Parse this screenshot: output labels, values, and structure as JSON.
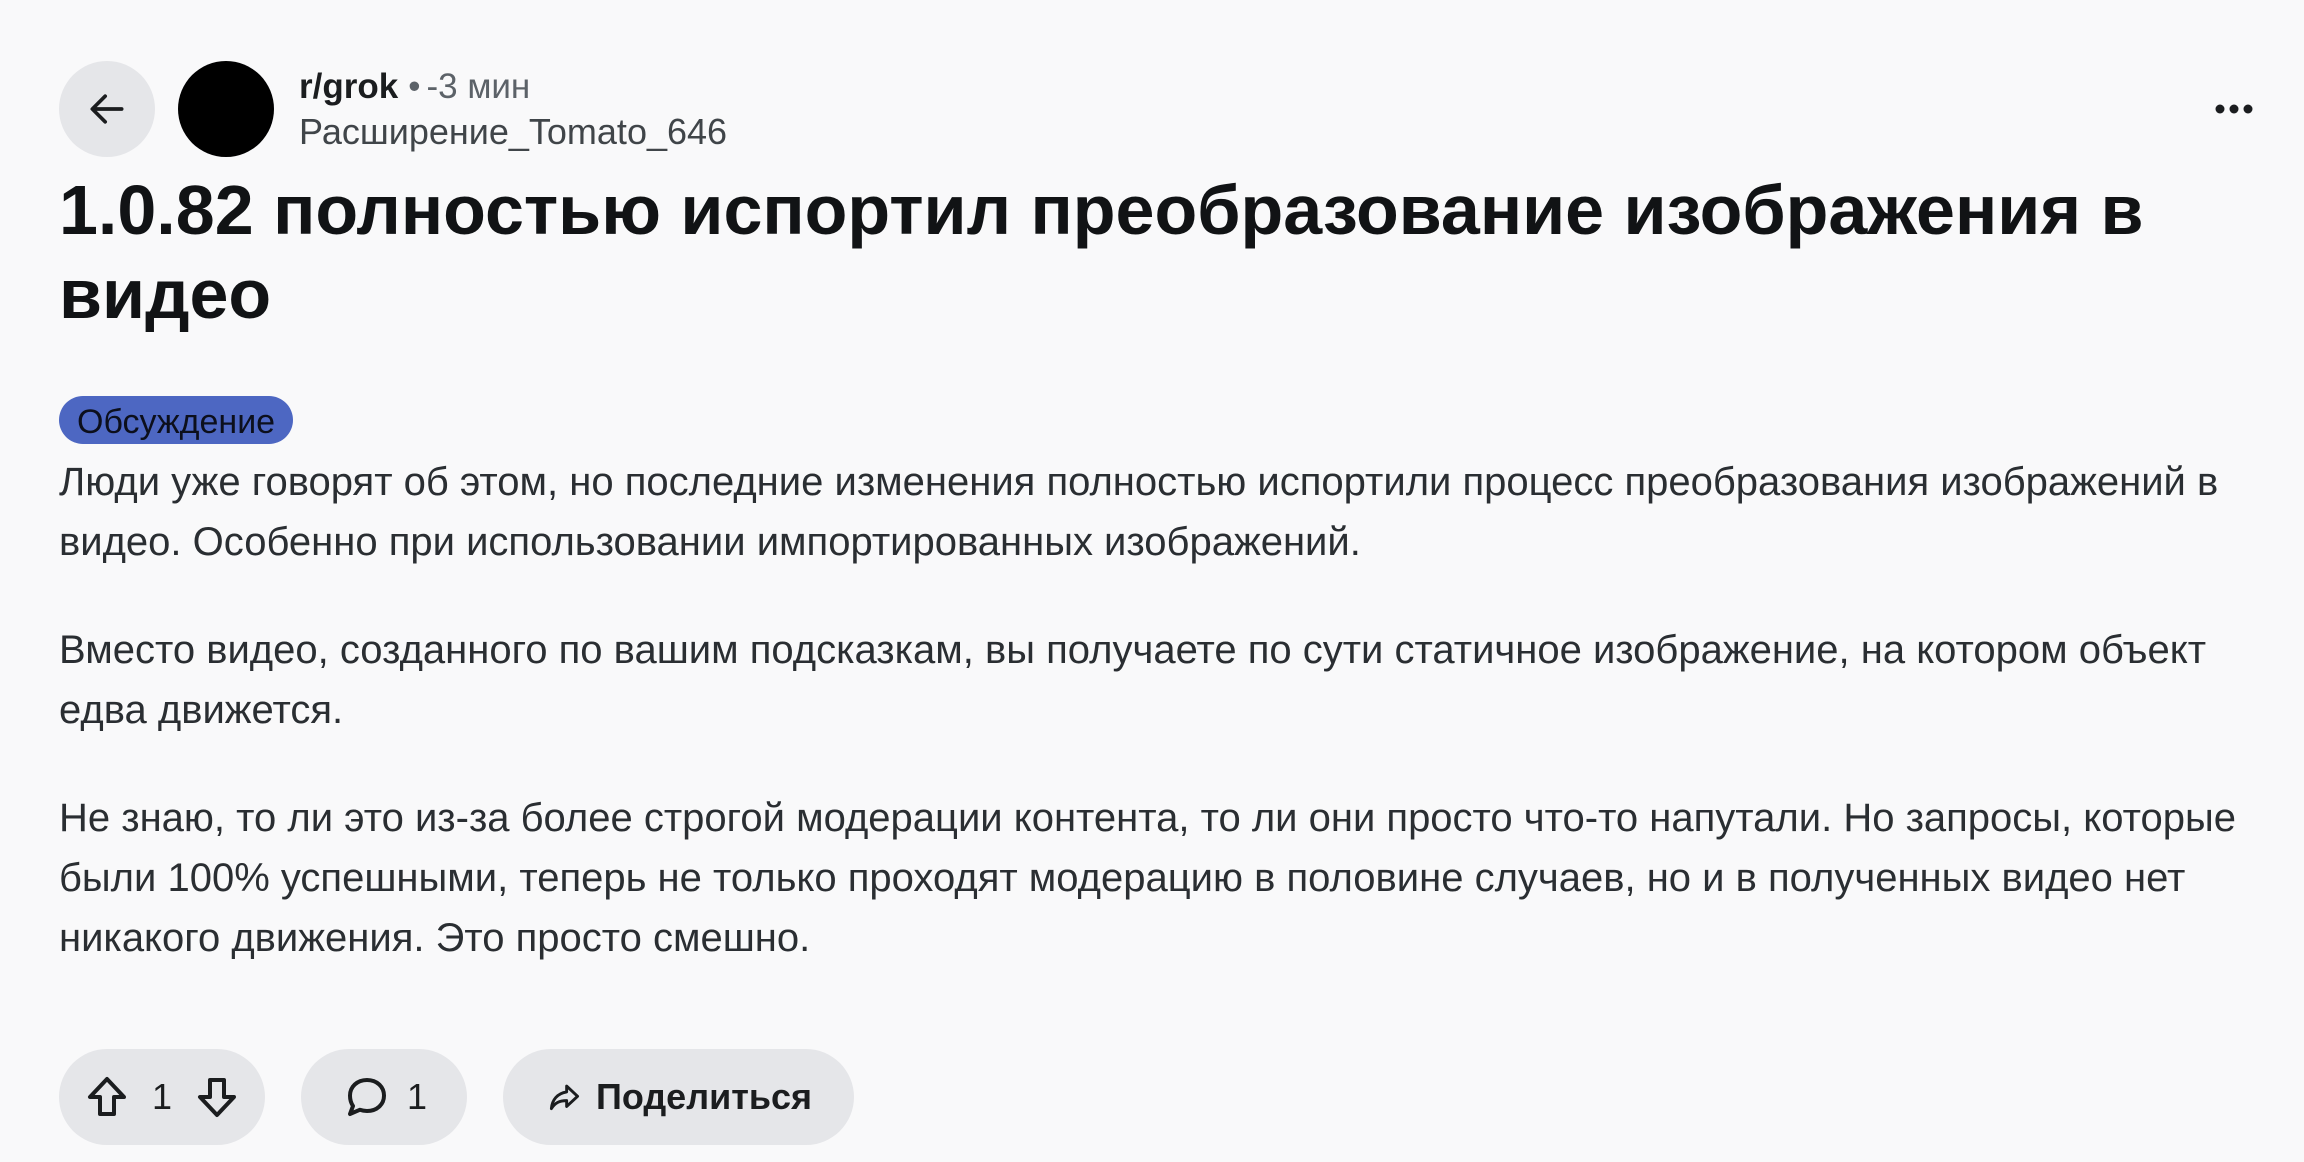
{
  "post": {
    "subreddit": "r/grok",
    "separator": "•",
    "time": "-3 мин",
    "author": "Расширение_Tomato_646",
    "title": "1.0.82 полностью испортил преобразование изображения в видео",
    "flair": "Обсуждение",
    "flair_color": "#4d67c2",
    "paragraphs": [
      "Люди уже говорят об этом, но последние изменения полностью испортили процесс преобразования изображений в видео. Особенно при использовании импортированных изображений.",
      "Вместо видео, созданного по вашим подсказкам, вы получаете по сути статичное изображение, на котором объект едва движется.",
      "Не знаю, то ли это из-за более строгой модерации контента, то ли они просто что-то напутали. Но запросы, которые были 100% успешными, теперь не только проходят модерацию в половине случаев, но и в полученных видео нет никакого движения. Это просто смешно."
    ]
  },
  "actions": {
    "vote_count": "1",
    "comment_count": "1",
    "share_label": "Поделиться"
  },
  "icons": {
    "back": "arrow-left-icon",
    "more": "more-horizontal-icon",
    "upvote": "arrow-up-icon",
    "downvote": "arrow-down-icon",
    "comment": "speech-bubble-icon",
    "share": "share-arrow-icon"
  }
}
